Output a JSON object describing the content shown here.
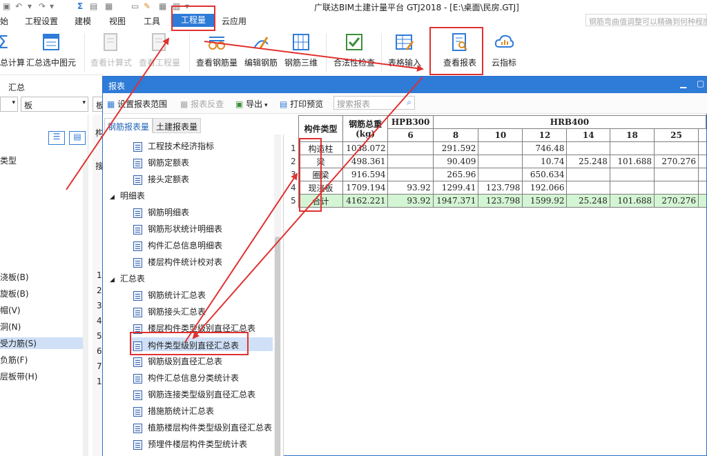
{
  "window": {
    "title": "广联达BIM土建计量平台 GTJ2018 - [E:\\桌面\\民房.GTJ]",
    "hint": "钢筋弯曲值调整可以精确到何种程度"
  },
  "menu": {
    "items": [
      "始",
      "工程设置",
      "建模",
      "视图",
      "工具",
      "工程量",
      "云应用"
    ],
    "active": "工程量"
  },
  "ribbon": {
    "buttons": [
      "总计算",
      "汇总选中图元",
      "查看计算式",
      "查看工程量",
      "查看钢筋量",
      "编辑钢筋",
      "钢筋三维",
      "合法性检查",
      "表格输入",
      "查看报表",
      "云指标"
    ],
    "group_label": "汇总"
  },
  "left": {
    "dropdown_value": "板",
    "dropdown2": "板",
    "type_label": "类型",
    "items": [
      "浇板(B)",
      "旋板(B)",
      "帽(V)",
      "洞(N)",
      "受力筋(S)",
      "负筋(F)",
      "层板带(H)"
    ],
    "mid_labels": [
      "构",
      "搜",
      "1",
      "2",
      "3",
      "4",
      "5",
      "6",
      "7",
      "1"
    ]
  },
  "dialog": {
    "title": "报表",
    "toolbar": {
      "set_range": "设置报表范围",
      "reverse": "报表反查",
      "export": "导出",
      "print": "打印预览",
      "search_placeholder": "搜索报表"
    },
    "tabs": [
      "钢筋报表量",
      "土建报表量"
    ],
    "tree": {
      "group1_items": [
        "工程技术经济指标",
        "钢筋定额表",
        "接头定额表"
      ],
      "group2": "明细表",
      "group2_items": [
        "钢筋明细表",
        "钢筋形状统计明细表",
        "构件汇总信息明细表",
        "楼层构件统计校对表"
      ],
      "group3": "汇总表",
      "group3_items": [
        "钢筋统计汇总表",
        "钢筋接头汇总表",
        "楼层构件类型级别直径汇总表",
        "构件类型级别直径汇总表",
        "钢筋级别直径汇总表",
        "构件汇总信息分类统计表",
        "钢筋连接类型级别直径汇总表",
        "措施筋统计汇总表",
        "植筋楼层构件类型级别直径汇总表",
        "预埋件楼层构件类型统计表"
      ],
      "selected": "构件类型级别直径汇总表"
    }
  },
  "report": {
    "header": {
      "type_col": "构件类型",
      "total_col": "钢筋总重(kg)",
      "grade1": "HPB300",
      "grade2": "HRB400",
      "diameters1": [
        "6"
      ],
      "diameters2": [
        "8",
        "10",
        "12",
        "14",
        "18",
        "25"
      ]
    },
    "rows": [
      {
        "idx": "1",
        "type": "构造柱",
        "total": "1038.072",
        "d6": "",
        "d8": "291.592",
        "d10": "",
        "d12": "746.48",
        "d14": "",
        "d18": "",
        "d25": ""
      },
      {
        "idx": "2",
        "type": "梁",
        "total": "498.361",
        "d6": "",
        "d8": "90.409",
        "d10": "",
        "d12": "10.74",
        "d14": "25.248",
        "d18": "101.688",
        "d25": "270.276"
      },
      {
        "idx": "3",
        "type": "圈梁",
        "total": "916.594",
        "d6": "",
        "d8": "265.96",
        "d10": "",
        "d12": "650.634",
        "d14": "",
        "d18": "",
        "d25": ""
      },
      {
        "idx": "4",
        "type": "现浇板",
        "total": "1709.194",
        "d6": "93.92",
        "d8": "1299.41",
        "d10": "123.798",
        "d12": "192.066",
        "d14": "",
        "d18": "",
        "d25": ""
      },
      {
        "idx": "5",
        "type": "合计",
        "total": "4162.221",
        "d6": "93.92",
        "d8": "1947.371",
        "d10": "123.798",
        "d12": "1599.92",
        "d14": "25.248",
        "d18": "101.688",
        "d25": "270.276"
      }
    ]
  },
  "colors": {
    "accent": "#2e7bd8",
    "annotation": "#e0302f",
    "total_row": "#d4f5d4"
  }
}
